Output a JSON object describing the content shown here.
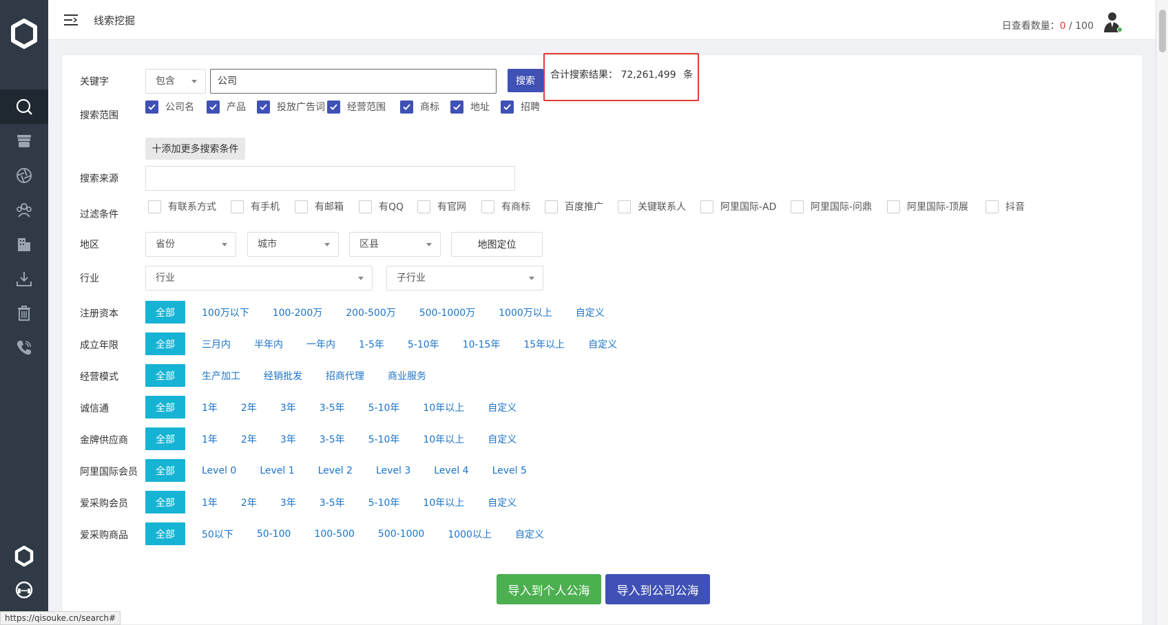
{
  "header": {
    "title": "线索挖掘",
    "quota_label": "日查看数量：",
    "quota_used": "0",
    "quota_total": " / 100"
  },
  "keyword": {
    "label": "关键字",
    "mode": "包含",
    "value": "公司",
    "search_button": "搜索",
    "result_prefix": "合计搜索结果：",
    "result_count": "72,261,499",
    "result_suffix": "条"
  },
  "scope": {
    "label": "搜索范围",
    "items": [
      "公司名",
      "产品",
      "投放广告词",
      "经营范围",
      "商标",
      "地址",
      "招聘"
    ]
  },
  "add_more": "十添加更多搜索条件",
  "source": {
    "label": "搜索来源",
    "value": ""
  },
  "filter": {
    "label": "过滤条件",
    "items": [
      "有联系方式",
      "有手机",
      "有邮箱",
      "有QQ",
      "有官网",
      "有商标",
      "百度推广",
      "关键联系人",
      "阿里国际-AD",
      "阿里国际-问鼎",
      "阿里国际-顶展",
      "抖音"
    ]
  },
  "region": {
    "label": "地区",
    "province": "省份",
    "city": "城市",
    "district": "区县",
    "map_button": "地图定位"
  },
  "industry": {
    "label": "行业",
    "industry": "行业",
    "sub_industry": "子行业"
  },
  "option_rows": [
    {
      "label": "注册资本",
      "options": [
        "全部",
        "100万以下",
        "100-200万",
        "200-500万",
        "500-1000万",
        "1000万以上",
        "自定义"
      ]
    },
    {
      "label": "成立年限",
      "options": [
        "全部",
        "三月内",
        "半年内",
        "一年内",
        "1-5年",
        "5-10年",
        "10-15年",
        "15年以上",
        "自定义"
      ]
    },
    {
      "label": "经营模式",
      "options": [
        "全部",
        "生产加工",
        "经销批发",
        "招商代理",
        "商业服务"
      ]
    },
    {
      "label": "诚信通",
      "options": [
        "全部",
        "1年",
        "2年",
        "3年",
        "3-5年",
        "5-10年",
        "10年以上",
        "自定义"
      ]
    },
    {
      "label": "金牌供应商",
      "options": [
        "全部",
        "1年",
        "2年",
        "3年",
        "3-5年",
        "5-10年",
        "10年以上",
        "自定义"
      ]
    },
    {
      "label": "阿里国际会员",
      "options": [
        "全部",
        "Level 0",
        "Level 1",
        "Level 2",
        "Level 3",
        "Level 4",
        "Level 5"
      ]
    },
    {
      "label": "爱采购会员",
      "options": [
        "全部",
        "1年",
        "2年",
        "3年",
        "3-5年",
        "5-10年",
        "10年以上",
        "自定义"
      ]
    },
    {
      "label": "爱采购商品",
      "options": [
        "全部",
        "50以下",
        "50-100",
        "100-500",
        "500-1000",
        "1000以上",
        "自定义"
      ]
    }
  ],
  "actions": {
    "import_personal": "导入到个人公海",
    "import_company": "导入到公司公海"
  },
  "status_url": "https://qisouke.cn/search#",
  "colors": {
    "sidebar": "#2f3a46",
    "primary": "#3f51b5",
    "active_tag": "#17b3d5",
    "green": "#4caf50",
    "highlight": "#e53935"
  }
}
